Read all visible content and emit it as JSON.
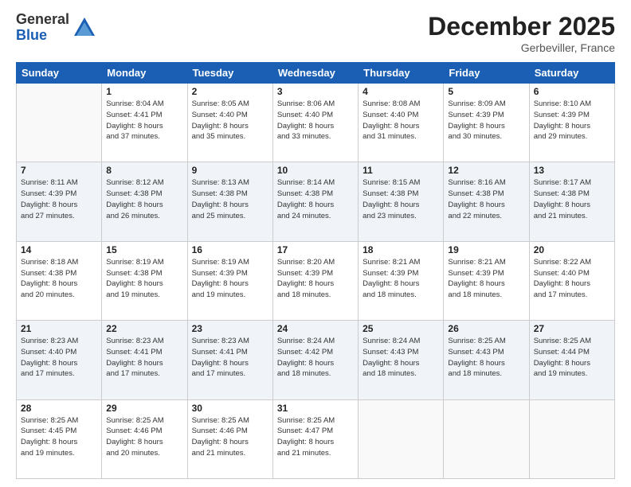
{
  "logo": {
    "general": "General",
    "blue": "Blue"
  },
  "title": {
    "month_year": "December 2025",
    "location": "Gerbeviller, France"
  },
  "days_of_week": [
    "Sunday",
    "Monday",
    "Tuesday",
    "Wednesday",
    "Thursday",
    "Friday",
    "Saturday"
  ],
  "weeks": [
    [
      {
        "num": "",
        "info": ""
      },
      {
        "num": "1",
        "info": "Sunrise: 8:04 AM\nSunset: 4:41 PM\nDaylight: 8 hours\nand 37 minutes."
      },
      {
        "num": "2",
        "info": "Sunrise: 8:05 AM\nSunset: 4:40 PM\nDaylight: 8 hours\nand 35 minutes."
      },
      {
        "num": "3",
        "info": "Sunrise: 8:06 AM\nSunset: 4:40 PM\nDaylight: 8 hours\nand 33 minutes."
      },
      {
        "num": "4",
        "info": "Sunrise: 8:08 AM\nSunset: 4:40 PM\nDaylight: 8 hours\nand 31 minutes."
      },
      {
        "num": "5",
        "info": "Sunrise: 8:09 AM\nSunset: 4:39 PM\nDaylight: 8 hours\nand 30 minutes."
      },
      {
        "num": "6",
        "info": "Sunrise: 8:10 AM\nSunset: 4:39 PM\nDaylight: 8 hours\nand 29 minutes."
      }
    ],
    [
      {
        "num": "7",
        "info": "Sunrise: 8:11 AM\nSunset: 4:39 PM\nDaylight: 8 hours\nand 27 minutes."
      },
      {
        "num": "8",
        "info": "Sunrise: 8:12 AM\nSunset: 4:38 PM\nDaylight: 8 hours\nand 26 minutes."
      },
      {
        "num": "9",
        "info": "Sunrise: 8:13 AM\nSunset: 4:38 PM\nDaylight: 8 hours\nand 25 minutes."
      },
      {
        "num": "10",
        "info": "Sunrise: 8:14 AM\nSunset: 4:38 PM\nDaylight: 8 hours\nand 24 minutes."
      },
      {
        "num": "11",
        "info": "Sunrise: 8:15 AM\nSunset: 4:38 PM\nDaylight: 8 hours\nand 23 minutes."
      },
      {
        "num": "12",
        "info": "Sunrise: 8:16 AM\nSunset: 4:38 PM\nDaylight: 8 hours\nand 22 minutes."
      },
      {
        "num": "13",
        "info": "Sunrise: 8:17 AM\nSunset: 4:38 PM\nDaylight: 8 hours\nand 21 minutes."
      }
    ],
    [
      {
        "num": "14",
        "info": "Sunrise: 8:18 AM\nSunset: 4:38 PM\nDaylight: 8 hours\nand 20 minutes."
      },
      {
        "num": "15",
        "info": "Sunrise: 8:19 AM\nSunset: 4:38 PM\nDaylight: 8 hours\nand 19 minutes."
      },
      {
        "num": "16",
        "info": "Sunrise: 8:19 AM\nSunset: 4:39 PM\nDaylight: 8 hours\nand 19 minutes."
      },
      {
        "num": "17",
        "info": "Sunrise: 8:20 AM\nSunset: 4:39 PM\nDaylight: 8 hours\nand 18 minutes."
      },
      {
        "num": "18",
        "info": "Sunrise: 8:21 AM\nSunset: 4:39 PM\nDaylight: 8 hours\nand 18 minutes."
      },
      {
        "num": "19",
        "info": "Sunrise: 8:21 AM\nSunset: 4:39 PM\nDaylight: 8 hours\nand 18 minutes."
      },
      {
        "num": "20",
        "info": "Sunrise: 8:22 AM\nSunset: 4:40 PM\nDaylight: 8 hours\nand 17 minutes."
      }
    ],
    [
      {
        "num": "21",
        "info": "Sunrise: 8:23 AM\nSunset: 4:40 PM\nDaylight: 8 hours\nand 17 minutes."
      },
      {
        "num": "22",
        "info": "Sunrise: 8:23 AM\nSunset: 4:41 PM\nDaylight: 8 hours\nand 17 minutes."
      },
      {
        "num": "23",
        "info": "Sunrise: 8:23 AM\nSunset: 4:41 PM\nDaylight: 8 hours\nand 17 minutes."
      },
      {
        "num": "24",
        "info": "Sunrise: 8:24 AM\nSunset: 4:42 PM\nDaylight: 8 hours\nand 18 minutes."
      },
      {
        "num": "25",
        "info": "Sunrise: 8:24 AM\nSunset: 4:43 PM\nDaylight: 8 hours\nand 18 minutes."
      },
      {
        "num": "26",
        "info": "Sunrise: 8:25 AM\nSunset: 4:43 PM\nDaylight: 8 hours\nand 18 minutes."
      },
      {
        "num": "27",
        "info": "Sunrise: 8:25 AM\nSunset: 4:44 PM\nDaylight: 8 hours\nand 19 minutes."
      }
    ],
    [
      {
        "num": "28",
        "info": "Sunrise: 8:25 AM\nSunset: 4:45 PM\nDaylight: 8 hours\nand 19 minutes."
      },
      {
        "num": "29",
        "info": "Sunrise: 8:25 AM\nSunset: 4:46 PM\nDaylight: 8 hours\nand 20 minutes."
      },
      {
        "num": "30",
        "info": "Sunrise: 8:25 AM\nSunset: 4:46 PM\nDaylight: 8 hours\nand 21 minutes."
      },
      {
        "num": "31",
        "info": "Sunrise: 8:25 AM\nSunset: 4:47 PM\nDaylight: 8 hours\nand 21 minutes."
      },
      {
        "num": "",
        "info": ""
      },
      {
        "num": "",
        "info": ""
      },
      {
        "num": "",
        "info": ""
      }
    ]
  ]
}
